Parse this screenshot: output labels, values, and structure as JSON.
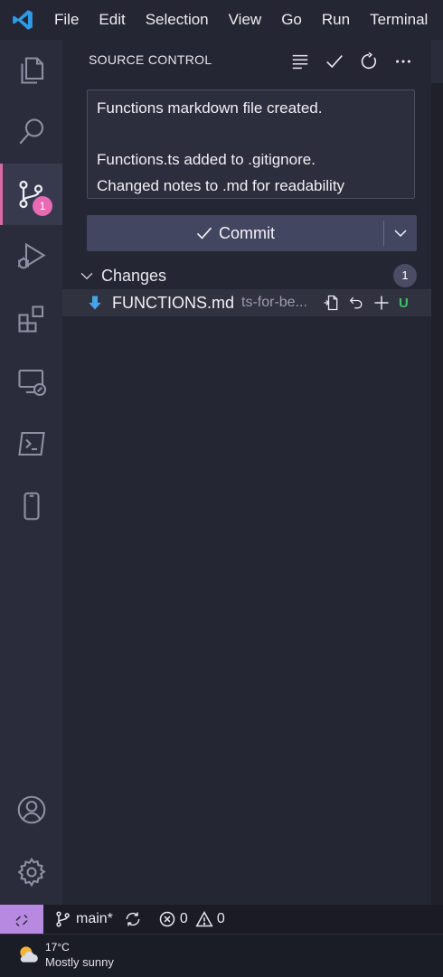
{
  "menu": {
    "items": [
      "File",
      "Edit",
      "Selection",
      "View",
      "Go",
      "Run",
      "Terminal"
    ]
  },
  "activity": {
    "icons": [
      "explorer-icon",
      "search-icon",
      "source-control-icon",
      "run-debug-icon",
      "extensions-icon",
      "remote-explorer-icon",
      "terminal-icon",
      "device-icon",
      "account-icon",
      "settings-gear-icon"
    ],
    "source_control_badge": "1",
    "accent_color": "#e86ab5"
  },
  "source_control": {
    "title": "SOURCE CONTROL",
    "commit_message_lines": [
      "Functions markdown file created.",
      "",
      "Functions.ts added to .gitignore.",
      "Changed notes to .md for readability"
    ],
    "commit_button_label": "Commit",
    "changes_label": "Changes",
    "changes_count": "1",
    "file": {
      "name": "FUNCTIONS.md",
      "path": "ts-for-be...",
      "status": "U",
      "status_color": "#39c16b"
    }
  },
  "statusbar": {
    "branch": "main*",
    "errors": "0",
    "warnings": "0",
    "remote_color": "#b889e0"
  },
  "taskbar": {
    "temperature": "17°C",
    "weather": "Mostly sunny"
  }
}
